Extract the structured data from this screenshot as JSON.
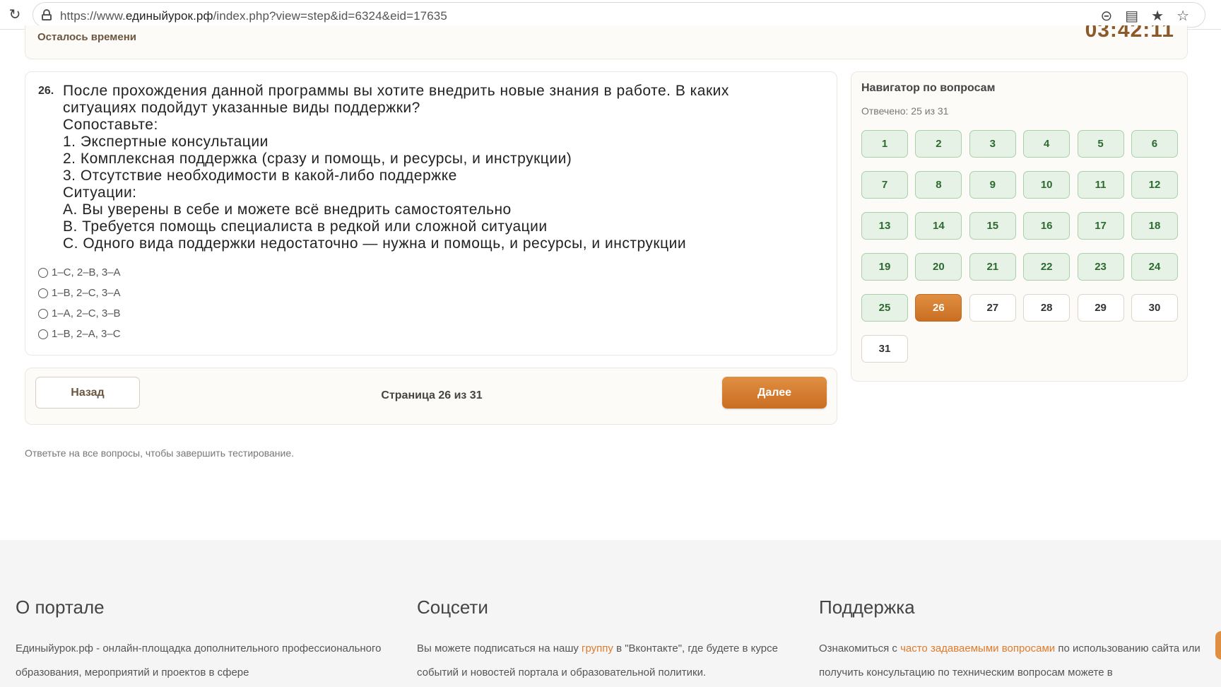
{
  "browser": {
    "url_prefix": "https://www.",
    "url_domain": "единыйурок.рф",
    "url_rest": "/index.php?view=step&id=6324&eid=17635",
    "reload_icon": "reload-icon",
    "icons": [
      "zoom-out-icon",
      "reader-mode-icon",
      "star-icon",
      "favorites-icon"
    ]
  },
  "timer": {
    "label": "Осталось времени",
    "value": "03:42:11"
  },
  "question": {
    "number": "26.",
    "lines": [
      "После прохождения данной программы вы хотите внедрить новые знания в работе. В каких",
      "ситуациях подойдут указанные виды поддержки?",
      "Сопоставьте:",
      "1. Экспертные консультации",
      "2. Комплексная поддержка (сразу и помощь, и ресурсы, и инструкции)",
      "3. Отсутствие необходимости в какой-либо поддержке",
      "Ситуации:",
      "A. Вы уверены в себе и можете всё внедрить самостоятельно",
      "B. Требуется помощь специалиста в редкой или сложной ситуации",
      "C. Одного вида поддержки недостаточно — нужна и помощь, и ресурсы, и инструкции"
    ],
    "options": [
      "1–C, 2–B, 3–A",
      "1–B, 2–C, 3–A",
      "1–A, 2–C, 3–B",
      "1–B, 2–A, 3–C"
    ]
  },
  "pager": {
    "back_label": "Назад",
    "page_info": "Страница 26 из 31",
    "next_label": "Далее"
  },
  "hint": "Ответьте на все вопросы, чтобы завершить тестирование.",
  "navigator": {
    "title": "Навигатор по вопросам",
    "answered_text": "Отвечено: 25 из 31",
    "current": 26,
    "answered_count": 25,
    "total": 31
  },
  "footer": {
    "about": {
      "title": "О портале",
      "text": "Единыйурок.рф - онлайн-площадка дополнительного профессионального образования, мероприятий и проектов в сфере"
    },
    "social": {
      "title": "Соцсети",
      "text_before": "Вы можете подписаться на нашу ",
      "link": "группу",
      "text_after": " в \"Вконтакте\", где будете в курсе событий и новостей портала и образовательной политики."
    },
    "support": {
      "title": "Поддержка",
      "text_before": "Ознакомиться с ",
      "link": "часто задаваемыми вопросами",
      "text_after": " по использованию сайта или получить консультацию по техническим вопросам можете в"
    }
  },
  "colors": {
    "accent": "#d47a2c",
    "answered_bg": "#e6f2e6",
    "answered_text": "#2d6a30"
  }
}
